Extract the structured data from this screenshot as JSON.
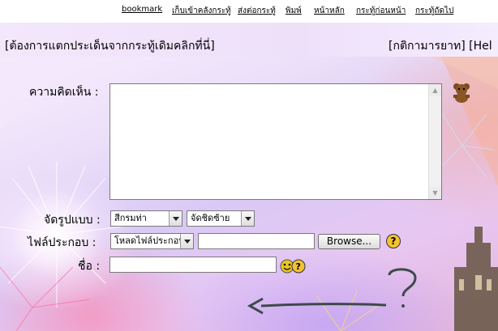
{
  "nav": [
    {
      "label": "bookmark"
    },
    {
      "label": "เก็บเข้าคลังกระทู้"
    },
    {
      "label": "ส่งต่อกระทู้"
    },
    {
      "label": "พิมพ์"
    },
    {
      "label": "หน้าหลัก"
    },
    {
      "label": "กระทู้ก่อนหน้า"
    },
    {
      "label": "กระทู้ถัดไป"
    }
  ],
  "topline": {
    "left": "[ต้องการแตกประเด็นจากกระทู้เดิมคลิกที่นี่]",
    "right": "[กติกามารยาท] [Hel"
  },
  "form": {
    "comment_label": "ความคิดเห็น :",
    "format_label": "จัดรูปแบบ :",
    "color_select": "สีกรมท่า",
    "align_select": "จัดชิดซ้าย",
    "file_label": "ไฟล์ประกอบ :",
    "file_type_select": "โหลดไฟล์ประกอบ",
    "browse_label": "Browse...",
    "help_symbol": "?",
    "name_label": "ชื่อ :"
  },
  "colors": {
    "nav_bg": "#ffffff",
    "arrow": "#3c4a4a"
  }
}
